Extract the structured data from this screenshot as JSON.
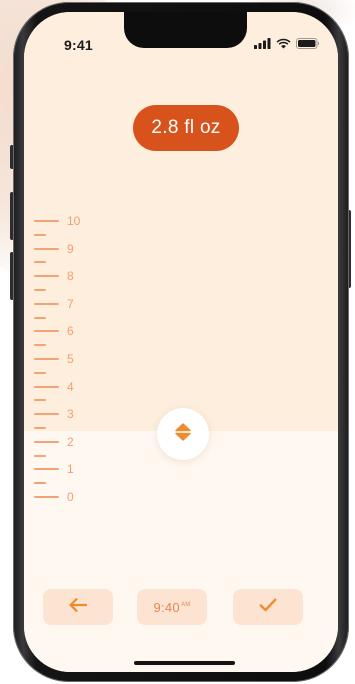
{
  "status_bar": {
    "time": "9:41",
    "signal_icon": "cellular-signal-icon",
    "wifi_icon": "wifi-icon",
    "battery_icon": "battery-icon"
  },
  "amount": {
    "value_label": "2.8 fl oz"
  },
  "ruler": {
    "labels": [
      "10",
      "9",
      "8",
      "7",
      "6",
      "5",
      "4",
      "3",
      "2",
      "1",
      "0"
    ]
  },
  "drag_handle": {
    "icon": "up-down-chevrons-icon"
  },
  "bottom_bar": {
    "back_icon": "arrow-left-icon",
    "time_value": "9:40",
    "time_suffix": "AM",
    "confirm_icon": "checkmark-icon"
  },
  "colors": {
    "accent": "#d8521b",
    "accent_light": "#fde4d2",
    "ruler": "#f2a476",
    "screen_upper": "#fdeedd",
    "screen_lower": "#fff8f1"
  }
}
